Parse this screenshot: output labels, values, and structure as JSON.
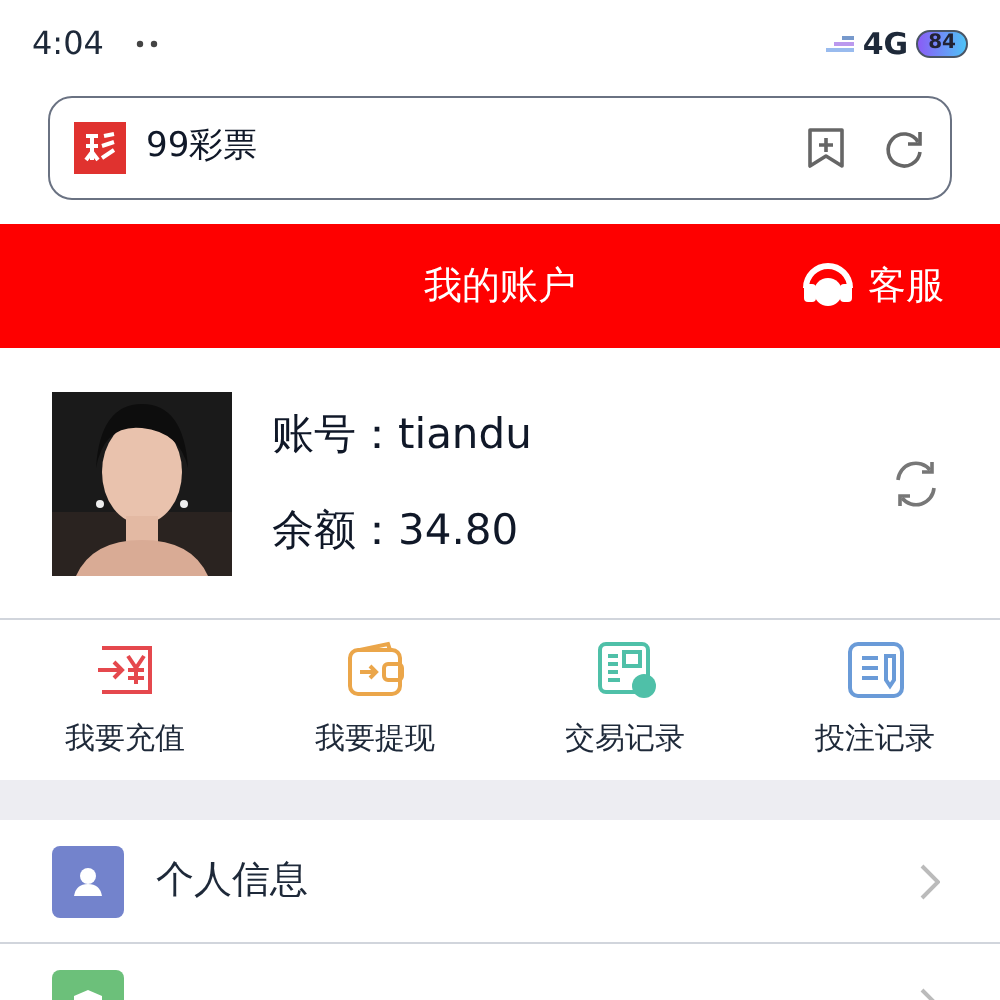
{
  "status_bar": {
    "time": "4:04",
    "network": "4G",
    "battery": "84"
  },
  "address_bar": {
    "title": "99彩票"
  },
  "header": {
    "title": "我的账户",
    "service": "客服"
  },
  "account": {
    "username": "账号：tiandu",
    "balance": "余额：34.80"
  },
  "shortcuts": [
    {
      "kind": "recharge",
      "label": "我要充值",
      "color": "#e5484d"
    },
    {
      "kind": "withdraw",
      "label": "我要提现",
      "color": "#eba64a"
    },
    {
      "kind": "transactions",
      "label": "交易记录",
      "color": "#4fc0a8"
    },
    {
      "kind": "bets",
      "label": "投注记录",
      "color": "#6a9bd8"
    }
  ],
  "menu": [
    {
      "kind": "person",
      "label": "个人信息",
      "color": "#7383cc"
    },
    {
      "kind": "security",
      "color": "#6cc07a"
    }
  ]
}
